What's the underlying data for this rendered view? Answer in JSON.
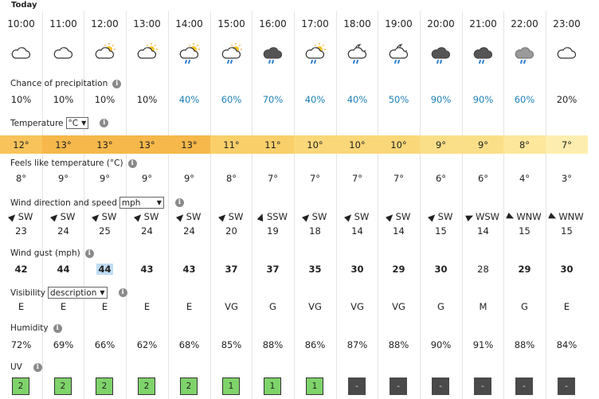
{
  "header": {
    "title": "Today"
  },
  "times": [
    "10:00",
    "11:00",
    "12:00",
    "13:00",
    "14:00",
    "15:00",
    "16:00",
    "17:00",
    "18:00",
    "19:00",
    "20:00",
    "21:00",
    "22:00",
    "23:00"
  ],
  "icons": [
    "cloud-icon",
    "cloud-icon",
    "sun-cloud-icon",
    "sun-cloud-icon",
    "sun-cloud-rain-icon",
    "sun-cloud-rain-icon",
    "dark-cloud-rain-icon",
    "sun-cloud-rain-icon",
    "moon-cloud-rain-icon",
    "moon-cloud-rain-icon",
    "dark-cloud-rain-icon",
    "dark-cloud-rain-icon",
    "grey-cloud-rain-icon",
    "cloud-icon"
  ],
  "precip": {
    "label": "Chance of precipitation",
    "values": [
      "10%",
      "10%",
      "10%",
      "10%",
      "40%",
      "60%",
      "70%",
      "40%",
      "40%",
      "50%",
      "90%",
      "90%",
      "60%",
      "20%"
    ]
  },
  "temperature": {
    "label": "Temperature",
    "unit_select": "°C",
    "values": [
      "12°",
      "13°",
      "13°",
      "13°",
      "13°",
      "11°",
      "11°",
      "10°",
      "10°",
      "10°",
      "9°",
      "9°",
      "8°",
      "7°"
    ],
    "colors": [
      "#f8c35a",
      "#f6b84a",
      "#f6b84a",
      "#f6b84a",
      "#f6b84a",
      "#f9cf6a",
      "#f9cf6a",
      "#fad778",
      "#fad778",
      "#fad778",
      "#fbdf88",
      "#fbdf88",
      "#fce79a",
      "#fdeeaf"
    ]
  },
  "feels_like": {
    "label": "Feels like temperature (°C)",
    "values": [
      "8°",
      "9°",
      "9°",
      "9°",
      "9°",
      "8°",
      "7°",
      "7°",
      "7°",
      "7°",
      "6°",
      "6°",
      "4°",
      "3°"
    ]
  },
  "wind": {
    "label": "Wind direction and speed",
    "unit_select": "mph",
    "directions": [
      "SW",
      "SW",
      "SW",
      "SW",
      "SW",
      "SW",
      "SSW",
      "SW",
      "SW",
      "SW",
      "SW",
      "WSW",
      "WNW",
      "WNW"
    ],
    "rotations": [
      225,
      225,
      225,
      225,
      225,
      225,
      200,
      225,
      225,
      225,
      225,
      245,
      295,
      295
    ],
    "speeds": [
      "23",
      "24",
      "25",
      "24",
      "24",
      "20",
      "19",
      "18",
      "14",
      "14",
      "15",
      "14",
      "15",
      "15"
    ]
  },
  "gust": {
    "label": "Wind gust (mph)",
    "values": [
      "42",
      "44",
      "44",
      "43",
      "43",
      "37",
      "37",
      "35",
      "30",
      "29",
      "30",
      "28",
      "29",
      "30"
    ]
  },
  "visibility": {
    "label": "Visibility",
    "select": "description",
    "values": [
      "E",
      "E",
      "E",
      "E",
      "E",
      "VG",
      "G",
      "VG",
      "VG",
      "VG",
      "G",
      "M",
      "G",
      "E"
    ]
  },
  "humidity": {
    "label": "Humidity",
    "values": [
      "72%",
      "69%",
      "66%",
      "62%",
      "68%",
      "85%",
      "88%",
      "86%",
      "87%",
      "88%",
      "90%",
      "91%",
      "88%",
      "84%"
    ]
  },
  "uv": {
    "label": "UV",
    "values": [
      "2",
      "2",
      "2",
      "2",
      "2",
      "1",
      "1",
      "1",
      "-",
      "-",
      "-",
      "-",
      "-",
      "-"
    ]
  }
}
